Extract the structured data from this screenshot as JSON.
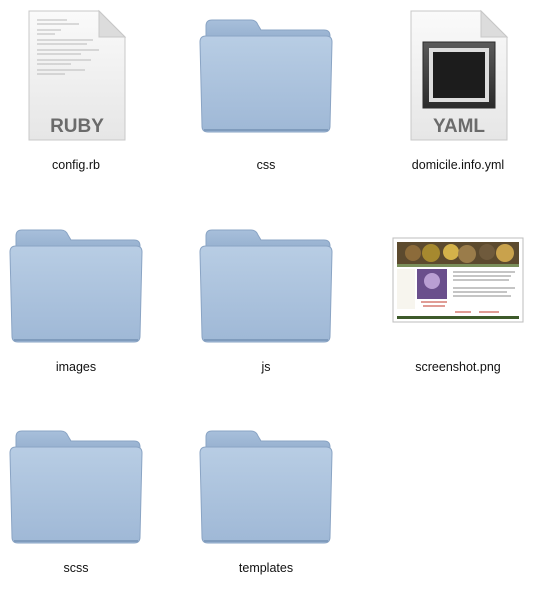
{
  "items": [
    {
      "name": "config.rb",
      "kind": "document",
      "badge": "RUBY",
      "icon": "ruby-file-icon"
    },
    {
      "name": "css",
      "kind": "folder",
      "icon": "folder-icon"
    },
    {
      "name": "domicile.info.yml",
      "kind": "document",
      "badge": "YAML",
      "icon": "yaml-file-icon"
    },
    {
      "name": "images",
      "kind": "folder",
      "icon": "folder-icon"
    },
    {
      "name": "js",
      "kind": "folder",
      "icon": "folder-icon"
    },
    {
      "name": "screenshot.png",
      "kind": "image",
      "icon": "image-thumbnail-icon"
    },
    {
      "name": "scss",
      "kind": "folder",
      "icon": "folder-icon"
    },
    {
      "name": "templates",
      "kind": "folder",
      "icon": "folder-icon"
    }
  ],
  "colors": {
    "folder_front": "#a9c2dd",
    "folder_back": "#93aecd",
    "folder_edge": "#7f9bbc",
    "doc_fill": "#f2f2f2",
    "badge_text": "#6b6b6b"
  }
}
